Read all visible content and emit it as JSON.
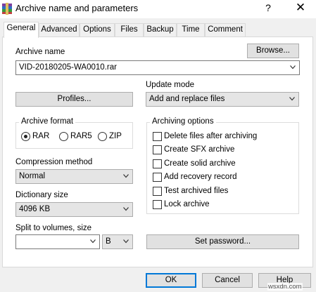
{
  "window": {
    "title": "Archive name and parameters",
    "help_glyph": "?",
    "close_glyph": "✕"
  },
  "tabs": [
    {
      "label": "General",
      "active": true
    },
    {
      "label": "Advanced"
    },
    {
      "label": "Options"
    },
    {
      "label": "Files"
    },
    {
      "label": "Backup"
    },
    {
      "label": "Time"
    },
    {
      "label": "Comment"
    }
  ],
  "archive_name": {
    "label": "Archive name",
    "value": "VID-20180205-WA0010.rar",
    "browse_label": "Browse..."
  },
  "profiles_label": "Profiles...",
  "update_mode": {
    "label": "Update mode",
    "value": "Add and replace files"
  },
  "archive_format": {
    "label": "Archive format",
    "options": [
      "RAR",
      "RAR5",
      "ZIP"
    ],
    "selected": "RAR"
  },
  "archiving_options": {
    "label": "Archiving options",
    "items": [
      {
        "label": "Delete files after archiving",
        "checked": false
      },
      {
        "label": "Create SFX archive",
        "checked": false
      },
      {
        "label": "Create solid archive",
        "checked": false
      },
      {
        "label": "Add recovery record",
        "checked": false
      },
      {
        "label": "Test archived files",
        "checked": false
      },
      {
        "label": "Lock archive",
        "checked": false
      }
    ]
  },
  "compression_method": {
    "label": "Compression method",
    "value": "Normal"
  },
  "dictionary_size": {
    "label": "Dictionary size",
    "value": "4096 KB"
  },
  "split_volumes": {
    "label": "Split to volumes, size",
    "value": "",
    "unit": "B"
  },
  "set_password_label": "Set password...",
  "footer": {
    "ok": "OK",
    "cancel": "Cancel",
    "help": "Help"
  },
  "watermark": "wsxdn.com",
  "colors": {
    "accent": "#0078d7",
    "dialog_bg": "#f0f0f0",
    "panel_bg": "#ffffff"
  },
  "icons": {
    "app": "winrar-books-icon",
    "dropdown": "chevron-down-icon"
  }
}
